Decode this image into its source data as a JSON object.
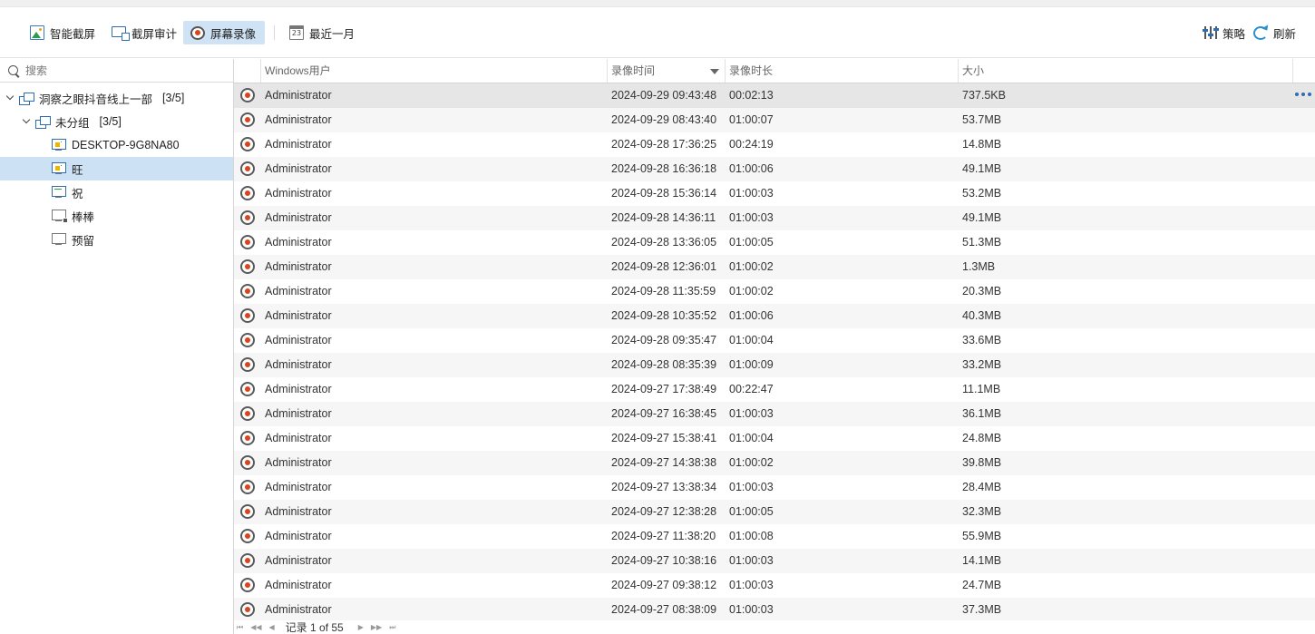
{
  "toolbar": {
    "smart_capture": "智能截屏",
    "capture_audit": "截屏审计",
    "screen_record": "屏幕录像",
    "date_range": "最近一月",
    "calendar_day": "23",
    "policy": "策略",
    "refresh": "刷新"
  },
  "search": {
    "placeholder": "搜索"
  },
  "tree": {
    "root": {
      "label": "洞察之眼抖音线上一部",
      "count": "[3/5]"
    },
    "group": {
      "label": "未分组",
      "count": "[3/5]"
    },
    "computers": [
      {
        "label": "DESKTOP-9G8NA80",
        "state": "online-warning"
      },
      {
        "label": "旺",
        "state": "online-warning",
        "selected": true
      },
      {
        "label": "祝",
        "state": "online"
      },
      {
        "label": "棒棒",
        "state": "offline-locked"
      },
      {
        "label": "预留",
        "state": "offline"
      }
    ]
  },
  "grid": {
    "columns": {
      "user": "Windows用户",
      "time": "录像时间",
      "duration": "录像时长",
      "size": "大小"
    },
    "sort": {
      "column": "time",
      "direction": "descending"
    },
    "rows": [
      {
        "user": "Administrator",
        "time": "2024-09-29 09:43:48",
        "duration": "00:02:13",
        "size": "737.5KB"
      },
      {
        "user": "Administrator",
        "time": "2024-09-29 08:43:40",
        "duration": "01:00:07",
        "size": "53.7MB"
      },
      {
        "user": "Administrator",
        "time": "2024-09-28 17:36:25",
        "duration": "00:24:19",
        "size": "14.8MB"
      },
      {
        "user": "Administrator",
        "time": "2024-09-28 16:36:18",
        "duration": "01:00:06",
        "size": "49.1MB"
      },
      {
        "user": "Administrator",
        "time": "2024-09-28 15:36:14",
        "duration": "01:00:03",
        "size": "53.2MB"
      },
      {
        "user": "Administrator",
        "time": "2024-09-28 14:36:11",
        "duration": "01:00:03",
        "size": "49.1MB"
      },
      {
        "user": "Administrator",
        "time": "2024-09-28 13:36:05",
        "duration": "01:00:05",
        "size": "51.3MB"
      },
      {
        "user": "Administrator",
        "time": "2024-09-28 12:36:01",
        "duration": "01:00:02",
        "size": "1.3MB"
      },
      {
        "user": "Administrator",
        "time": "2024-09-28 11:35:59",
        "duration": "01:00:02",
        "size": "20.3MB"
      },
      {
        "user": "Administrator",
        "time": "2024-09-28 10:35:52",
        "duration": "01:00:06",
        "size": "40.3MB"
      },
      {
        "user": "Administrator",
        "time": "2024-09-28 09:35:47",
        "duration": "01:00:04",
        "size": "33.6MB"
      },
      {
        "user": "Administrator",
        "time": "2024-09-28 08:35:39",
        "duration": "01:00:09",
        "size": "33.2MB"
      },
      {
        "user": "Administrator",
        "time": "2024-09-27 17:38:49",
        "duration": "00:22:47",
        "size": "11.1MB"
      },
      {
        "user": "Administrator",
        "time": "2024-09-27 16:38:45",
        "duration": "01:00:03",
        "size": "36.1MB"
      },
      {
        "user": "Administrator",
        "time": "2024-09-27 15:38:41",
        "duration": "01:00:04",
        "size": "24.8MB"
      },
      {
        "user": "Administrator",
        "time": "2024-09-27 14:38:38",
        "duration": "01:00:02",
        "size": "39.8MB"
      },
      {
        "user": "Administrator",
        "time": "2024-09-27 13:38:34",
        "duration": "01:00:03",
        "size": "28.4MB"
      },
      {
        "user": "Administrator",
        "time": "2024-09-27 12:38:28",
        "duration": "01:00:05",
        "size": "32.3MB"
      },
      {
        "user": "Administrator",
        "time": "2024-09-27 11:38:20",
        "duration": "01:00:08",
        "size": "55.9MB"
      },
      {
        "user": "Administrator",
        "time": "2024-09-27 10:38:16",
        "duration": "01:00:03",
        "size": "14.1MB"
      },
      {
        "user": "Administrator",
        "time": "2024-09-27 09:38:12",
        "duration": "01:00:03",
        "size": "24.7MB"
      },
      {
        "user": "Administrator",
        "time": "2024-09-27 08:38:09",
        "duration": "01:00:03",
        "size": "37.3MB"
      }
    ]
  },
  "pager": {
    "first": "⏮",
    "prev_page": "◀◀",
    "prev": "◀",
    "label": "记录 1 of 55",
    "next": "▶",
    "next_page": "▶▶",
    "last": "⏭"
  },
  "colors": {
    "accent": "#2f6db0",
    "record_red": "#d9441d",
    "selected_bg": "#cce1f4",
    "active_btn": "#cfe3f5"
  }
}
